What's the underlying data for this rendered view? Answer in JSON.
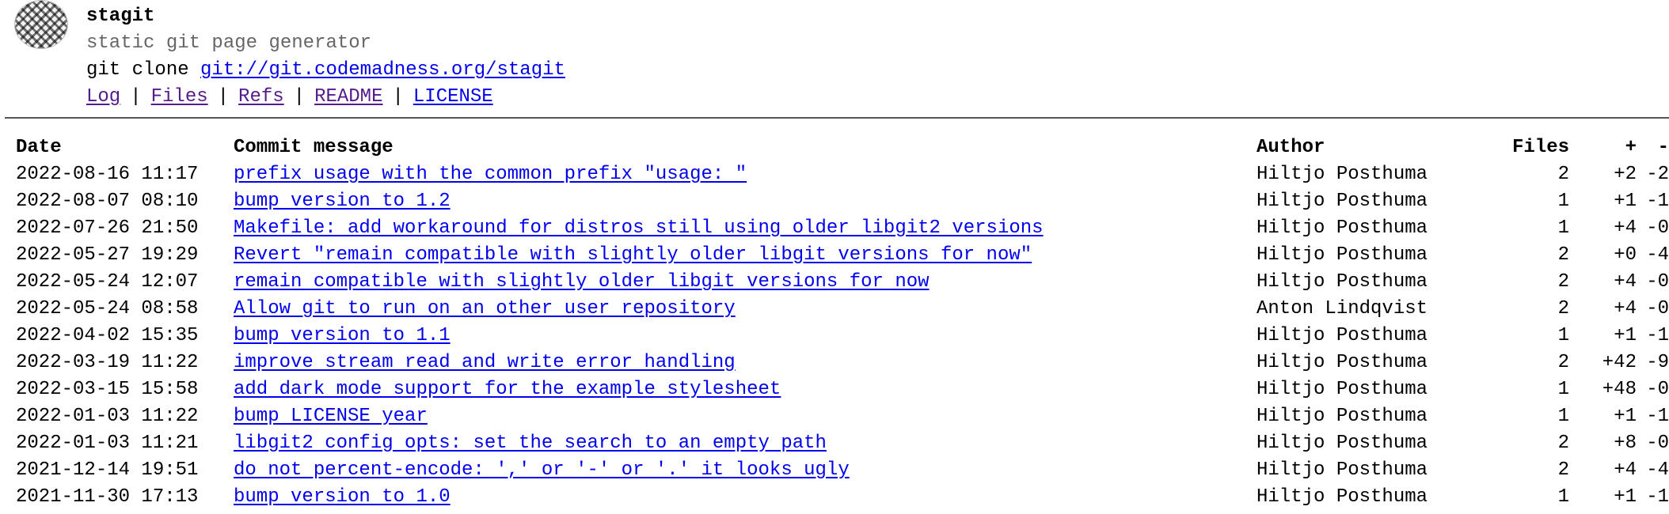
{
  "repo": {
    "name": "stagit",
    "description": "static git page generator",
    "clone_prefix": "git clone",
    "clone_url": "git://git.codemadness.org/stagit"
  },
  "nav": [
    {
      "label": "Log",
      "visited": true
    },
    {
      "label": "Files",
      "visited": true
    },
    {
      "label": "Refs",
      "visited": true
    },
    {
      "label": "README",
      "visited": true
    },
    {
      "label": "LICENSE",
      "visited": false
    }
  ],
  "nav_separator": "|",
  "table": {
    "headers": {
      "date": "Date",
      "message": "Commit message",
      "author": "Author",
      "files": "Files",
      "plus": "+",
      "minus": "-"
    },
    "rows": [
      {
        "date": "2022-08-16 11:17",
        "message": "prefix usage with the common prefix \"usage: \"",
        "author": "Hiltjo Posthuma",
        "files": "2",
        "plus": "+2",
        "minus": "-2"
      },
      {
        "date": "2022-08-07 08:10",
        "message": "bump version to 1.2",
        "author": "Hiltjo Posthuma",
        "files": "1",
        "plus": "+1",
        "minus": "-1"
      },
      {
        "date": "2022-07-26 21:50",
        "message": "Makefile: add workaround for distros still using older libgit2 versions",
        "author": "Hiltjo Posthuma",
        "files": "1",
        "plus": "+4",
        "minus": "-0"
      },
      {
        "date": "2022-05-27 19:29",
        "message": "Revert \"remain compatible with slightly older libgit versions for now\"",
        "author": "Hiltjo Posthuma",
        "files": "2",
        "plus": "+0",
        "minus": "-4"
      },
      {
        "date": "2022-05-24 12:07",
        "message": "remain compatible with slightly older libgit versions for now",
        "author": "Hiltjo Posthuma",
        "files": "2",
        "plus": "+4",
        "minus": "-0"
      },
      {
        "date": "2022-05-24 08:58",
        "message": "Allow git to run on an other user repository",
        "author": "Anton Lindqvist",
        "files": "2",
        "plus": "+4",
        "minus": "-0"
      },
      {
        "date": "2022-04-02 15:35",
        "message": "bump version to 1.1",
        "author": "Hiltjo Posthuma",
        "files": "1",
        "plus": "+1",
        "minus": "-1"
      },
      {
        "date": "2022-03-19 11:22",
        "message": "improve stream read and write error handling",
        "author": "Hiltjo Posthuma",
        "files": "2",
        "plus": "+42",
        "minus": "-9"
      },
      {
        "date": "2022-03-15 15:58",
        "message": "add dark mode support for the example stylesheet",
        "author": "Hiltjo Posthuma",
        "files": "1",
        "plus": "+48",
        "minus": "-0"
      },
      {
        "date": "2022-01-03 11:22",
        "message": "bump LICENSE year",
        "author": "Hiltjo Posthuma",
        "files": "1",
        "plus": "+1",
        "minus": "-1"
      },
      {
        "date": "2022-01-03 11:21",
        "message": "libgit2 config opts: set the search to an empty path",
        "author": "Hiltjo Posthuma",
        "files": "2",
        "plus": "+8",
        "minus": "-0"
      },
      {
        "date": "2021-12-14 19:51",
        "message": "do not percent-encode: ',' or '-' or '.' it looks ugly",
        "author": "Hiltjo Posthuma",
        "files": "2",
        "plus": "+4",
        "minus": "-4"
      },
      {
        "date": "2021-11-30 17:13",
        "message": "bump version to 1.0",
        "author": "Hiltjo Posthuma",
        "files": "1",
        "plus": "+1",
        "minus": "-1"
      }
    ]
  },
  "colors": {
    "link": "#0000ee",
    "visited_link": "#551a8b",
    "description": "#666666",
    "rule": "#555555"
  },
  "icons": {
    "logo": "checkered-logo-icon"
  }
}
